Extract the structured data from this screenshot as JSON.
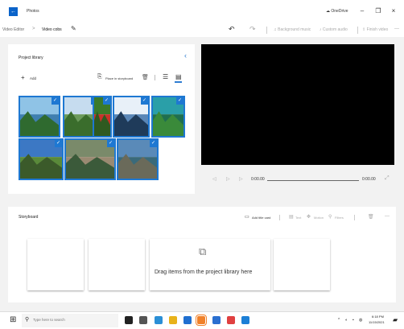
{
  "window": {
    "app_name": "Photos",
    "onedrive_label": "OneDrive",
    "minimize": "–",
    "maximize": "❐",
    "close": "×"
  },
  "toolbar": {
    "breadcrumb_parent": "Video Editor",
    "breadcrumb_sep": ">",
    "breadcrumb_current": "Video cobs",
    "undo": "↶",
    "redo": "↷",
    "background_music": "Background music",
    "custom_audio": "Custom audio",
    "finish_video": "Finish video",
    "more": "···"
  },
  "library": {
    "title": "Project library",
    "add_label": "Add",
    "place_label": "Place in storyboard",
    "thumbnails": [
      {
        "name": "lake-trees",
        "colors": [
          "#8fc3e6",
          "#3f7fb0",
          "#2f6a2f"
        ]
      },
      {
        "name": "mountain-valley",
        "colors": [
          "#c6dcef",
          "#6a9a5a",
          "#3a6d2c"
        ]
      },
      {
        "name": "tulips-red",
        "colors": [
          "#3b7a2a",
          "#c8322a",
          "#2f5a20"
        ]
      },
      {
        "name": "clouds-field",
        "colors": [
          "#e8f0f8",
          "#5a86b6",
          "#1f3b5a"
        ]
      },
      {
        "name": "turquoise-lake",
        "colors": [
          "#2a9fa8",
          "#1f6f4f",
          "#3a8a3a"
        ]
      },
      {
        "name": "alpine-sky",
        "colors": [
          "#3c78c4",
          "#5a8a3a",
          "#3b5a2a"
        ]
      },
      {
        "name": "stone-bridge",
        "colors": [
          "#7a8a6a",
          "#9a8a72",
          "#3b5a3a"
        ]
      },
      {
        "name": "coast-cliffs",
        "colors": [
          "#5a8ab8",
          "#3a6a7a",
          "#6a6a5a"
        ]
      }
    ]
  },
  "player": {
    "rewind": "◁",
    "play": "▷",
    "forward": "▷",
    "current_time": "0:00.00",
    "end_time": "0:00.00",
    "expand": "⤢"
  },
  "storyboard": {
    "title": "Storyboard",
    "add_title_card": "Add title card",
    "text": "Text",
    "motion": "Motion",
    "filters": "Filters",
    "more": "···",
    "drop_hint": "Drag items from the project library here"
  },
  "taskbar": {
    "search_placeholder": "Type here to search",
    "time": "6:18 PM",
    "date": "11/15/2021",
    "apps": [
      {
        "name": "task-view",
        "color": "#222222"
      },
      {
        "name": "taskbar-app-1",
        "color": "#555555"
      },
      {
        "name": "taskbar-app-2",
        "color": "#2b8fd6"
      },
      {
        "name": "taskbar-app-3",
        "color": "#e8b21a"
      },
      {
        "name": "taskbar-app-4",
        "color": "#1f6fd0"
      },
      {
        "name": "taskbar-app-5",
        "color": "#f0812a"
      },
      {
        "name": "taskbar-app-6",
        "color": "#2a6fd0"
      },
      {
        "name": "taskbar-app-7",
        "color": "#e04040"
      },
      {
        "name": "taskbar-app-8",
        "color": "#1c7fd6"
      }
    ]
  },
  "colors": {
    "accent": "#1e78d2",
    "panel_bg": "#f2f2f2",
    "preview_bg": "#000000"
  }
}
